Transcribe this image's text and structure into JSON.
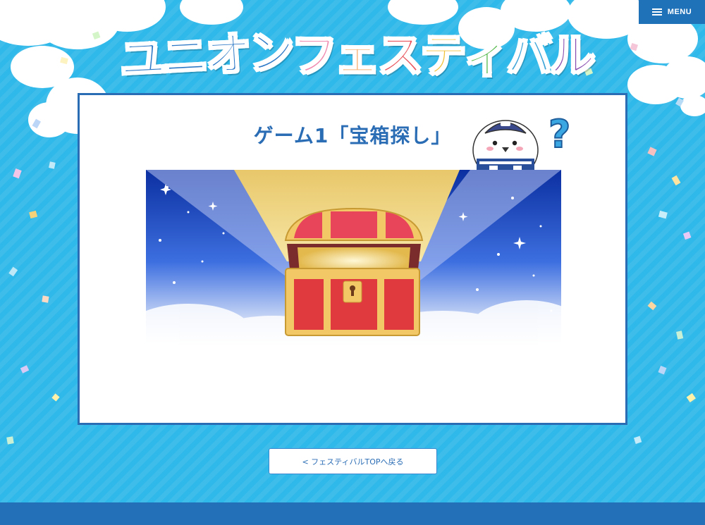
{
  "header": {
    "menu_label": "MENU",
    "logo_part1": "ユニオン",
    "logo_chars": [
      "フ",
      "ェ",
      "ス",
      "テ",
      "ィ",
      "バ",
      "ル"
    ],
    "logo_colors": [
      "#f08cb0",
      "#f5a35c",
      "#e8535b",
      "#f0c23a",
      "#52b848",
      "#3da4d8",
      "#8a4fb0"
    ]
  },
  "main": {
    "title": "ゲーム1「宝箱探し」",
    "banner_icon": "treasure-chest",
    "mascot_icon": "penguin-mascot-question"
  },
  "nav": {
    "back_label": "< フェスティバルTOPへ戻る"
  },
  "colors": {
    "background": "#2fb8ea",
    "panel_border": "#2b6db5",
    "footer": "#2370b8",
    "menu_bg": "#1f72b8"
  }
}
